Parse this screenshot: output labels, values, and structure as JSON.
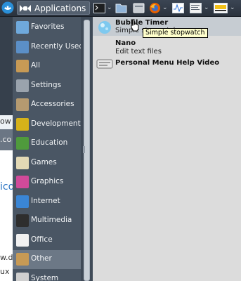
{
  "panel": {
    "applications_label": "Applications",
    "launchers": [
      "terminal-icon",
      "file-manager-icon",
      "folder-icon",
      "firefox-icon",
      "system-monitor-icon",
      "text-editor-icon",
      "media-player-icon"
    ]
  },
  "background": {
    "fragments": [
      "ow",
      ".co",
      "ico",
      "w.d",
      "ux"
    ]
  },
  "categories": [
    {
      "label": "Favorites",
      "icon": "favorites-icon",
      "color": "#6fa9dc"
    },
    {
      "label": "Recently Used",
      "icon": "recent-icon",
      "color": "#5b8fc7"
    },
    {
      "label": "All",
      "icon": "all-apps-icon",
      "color": "#c79a55"
    },
    {
      "label": "Settings",
      "icon": "settings-icon",
      "color": "#9aa3ad"
    },
    {
      "label": "Accessories",
      "icon": "accessories-icon",
      "color": "#b59a70"
    },
    {
      "label": "Development",
      "icon": "development-icon",
      "color": "#d6b21a"
    },
    {
      "label": "Education",
      "icon": "education-icon",
      "color": "#4f9a3c"
    },
    {
      "label": "Games",
      "icon": "games-icon",
      "color": "#e3d9b5"
    },
    {
      "label": "Graphics",
      "icon": "graphics-icon",
      "color": "#d04a9a"
    },
    {
      "label": "Internet",
      "icon": "internet-icon",
      "color": "#3a86d6"
    },
    {
      "label": "Multimedia",
      "icon": "multimedia-icon",
      "color": "#2e2e2e"
    },
    {
      "label": "Office",
      "icon": "office-icon",
      "color": "#f1f1f1"
    },
    {
      "label": "Other",
      "icon": "other-icon",
      "color": "#c79a55",
      "selected": true
    },
    {
      "label": "System",
      "icon": "system-icon",
      "color": "#cfcfcf"
    }
  ],
  "apps": [
    {
      "name": "Bubble Timer",
      "description": "Simple stopwatch",
      "icon": "bubble-timer-icon",
      "highlighted": true
    },
    {
      "name": "Nano",
      "description": "Edit text files",
      "icon": "nano-icon"
    },
    {
      "name": "Personal Menu Help Video",
      "description": "",
      "icon": "help-video-icon"
    }
  ],
  "tooltip": {
    "text": "Simple stopwatch"
  },
  "colors": {
    "panel_bg": "#2f3742",
    "category_bg": "#4a5664",
    "category_selected": "#6c7886",
    "list_bg": "#dcdcdc",
    "tooltip_bg": "#ffffcc"
  }
}
